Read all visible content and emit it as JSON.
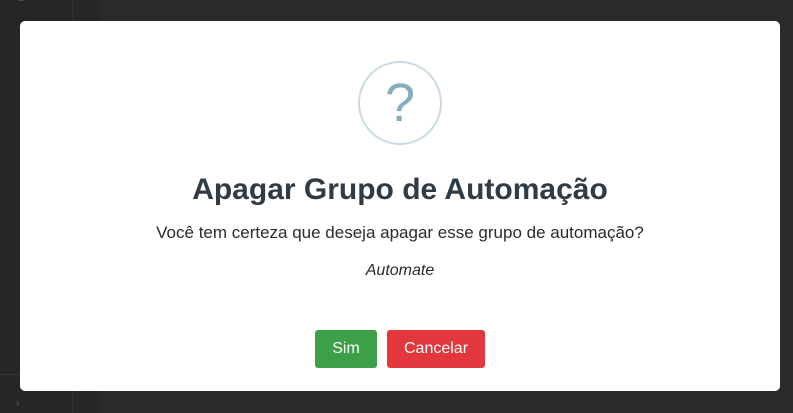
{
  "background": {
    "top_glyph": "≡",
    "bottom_glyph": "›"
  },
  "dialog": {
    "icon": "question-mark-icon",
    "icon_glyph": "?",
    "title": "Apagar Grupo de Automação",
    "message": "Você tem certeza que deseja apagar esse grupo de automação?",
    "item_name": "Automate",
    "confirm_label": "Sim",
    "cancel_label": "Cancelar"
  },
  "colors": {
    "confirm": "#3d9f47",
    "cancel": "#e2373c",
    "icon": "#87adbd",
    "title": "#2f3b45"
  }
}
